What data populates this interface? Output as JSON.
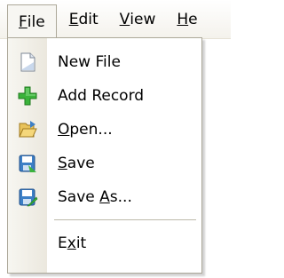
{
  "menubar": {
    "items": [
      {
        "label": "File",
        "underline": "F",
        "rest": "ile"
      },
      {
        "label": "Edit",
        "underline": "E",
        "rest": "dit"
      },
      {
        "label": "View",
        "underline": "V",
        "rest": "iew"
      },
      {
        "label": "He",
        "underline": "H",
        "rest": "e"
      }
    ]
  },
  "file_menu": {
    "items": [
      {
        "label": "New File",
        "icon": "new-file-icon"
      },
      {
        "label": "Add Record",
        "icon": "add-record-icon"
      },
      {
        "label_pre": "",
        "label_u": "O",
        "label_post": "pen...",
        "label": "Open...",
        "icon": "open-folder-icon"
      },
      {
        "label_pre": "",
        "label_u": "S",
        "label_post": "ave",
        "label": "Save",
        "icon": "save-icon"
      },
      {
        "label_pre": "Save ",
        "label_u": "A",
        "label_post": "s...",
        "label": "Save As...",
        "icon": "save-as-icon"
      },
      {
        "label_pre": "E",
        "label_u": "x",
        "label_post": "it",
        "label": "Exit"
      }
    ]
  },
  "colors": {
    "add_icon_green": "#3bb33b",
    "save_icon_blue": "#3c7fc6",
    "folder_yellow": "#e8c25a",
    "menu_border": "#aca899"
  }
}
